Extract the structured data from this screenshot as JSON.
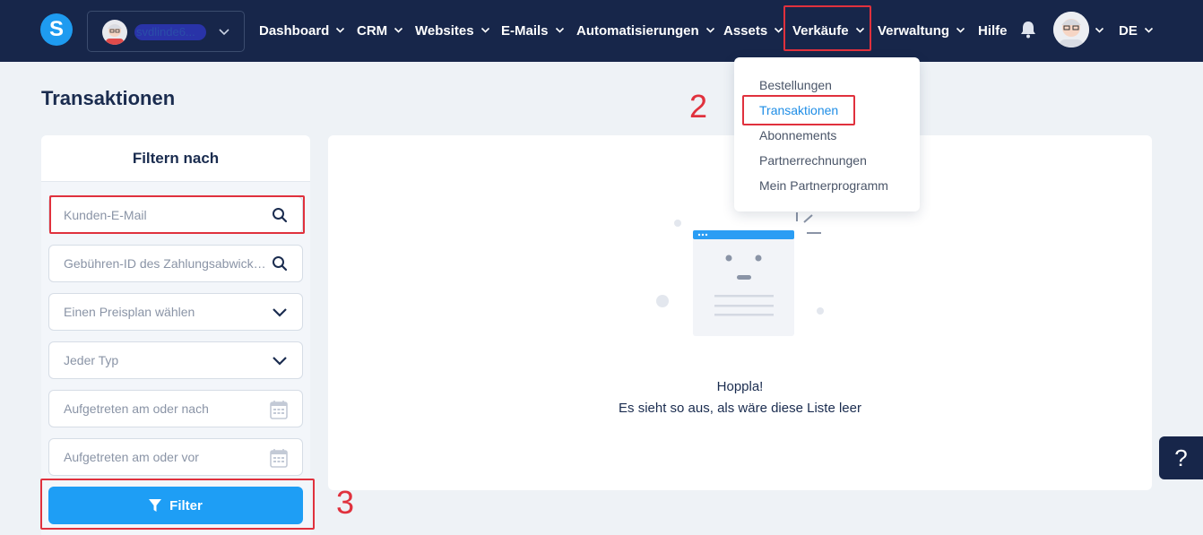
{
  "navbar": {
    "logo_letter": "S",
    "account_name": "svdlinde6...",
    "items": [
      {
        "label": "Dashboard"
      },
      {
        "label": "CRM"
      },
      {
        "label": "Websites"
      },
      {
        "label": "E-Mails"
      },
      {
        "label": "Automatisierungen"
      },
      {
        "label": "Assets"
      },
      {
        "label": "Verkäufe"
      },
      {
        "label": "Verwaltung"
      }
    ],
    "help_label": "Hilfe",
    "language": "DE"
  },
  "page": {
    "title": "Transaktionen"
  },
  "filter": {
    "heading": "Filtern nach",
    "email_placeholder": "Kunden-E-Mail",
    "fee_id_placeholder": "Gebühren-ID des Zahlungsabwicklers",
    "plan_placeholder": "Einen Preisplan wählen",
    "type_placeholder": "Jeder Typ",
    "after_placeholder": "Aufgetreten am oder nach",
    "before_placeholder": "Aufgetreten am oder vor",
    "button_label": "Filter"
  },
  "empty_state": {
    "title": "Hoppla!",
    "message": "Es sieht so aus, als wäre diese Liste leer"
  },
  "sales_menu": {
    "items": [
      {
        "label": "Bestellungen"
      },
      {
        "label": "Transaktionen"
      },
      {
        "label": "Abonnements"
      },
      {
        "label": "Partnerrechnungen"
      },
      {
        "label": "Mein Partnerprogramm"
      }
    ]
  },
  "annotations": {
    "step2": "2",
    "step3": "3"
  },
  "help_button": "?",
  "colors": {
    "navbar": "#17264a",
    "accent": "#1e9ef5",
    "highlight": "#e0313d"
  }
}
